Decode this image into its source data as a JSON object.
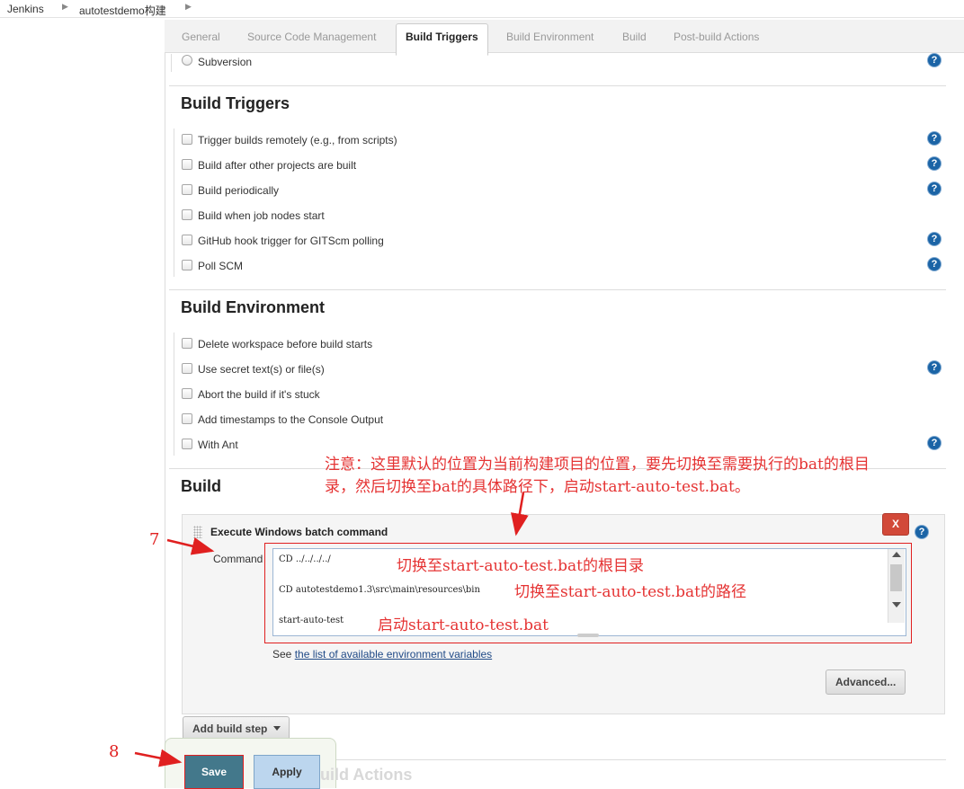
{
  "breadcrumb": {
    "home": "Jenkins",
    "job": "autotestdemo构建"
  },
  "tabs": [
    "General",
    "Source Code Management",
    "Build Triggers",
    "Build Environment",
    "Build",
    "Post-build Actions"
  ],
  "scm": {
    "subversion": "Subversion"
  },
  "build_triggers": {
    "title": "Build Triggers",
    "options": [
      "Trigger builds remotely (e.g., from scripts)",
      "Build after other projects are built",
      "Build periodically",
      "Build when job nodes start",
      "GitHub hook trigger for GITScm polling",
      "Poll SCM"
    ]
  },
  "build_env": {
    "title": "Build Environment",
    "options": [
      "Delete workspace before build starts",
      "Use secret text(s) or file(s)",
      "Abort the build if it's stuck",
      "Add timestamps to the Console Output",
      "With Ant"
    ]
  },
  "build": {
    "title": "Build",
    "step_title": "Execute Windows batch command",
    "delete_label": "X",
    "command_label": "Command",
    "command_lines": [
      "CD ../../../../",
      "CD autotestdemo1.3\\src\\main\\resources\\bin",
      "start-auto-test"
    ],
    "see_prefix": "See",
    "see_link": "the list of available environment variables",
    "advanced": "Advanced...",
    "add_step": "Add build step"
  },
  "annotations": {
    "note_line1": "注意：这里默认的位置为当前构建项目的位置，要先切换至需要执行的bat的根目",
    "note_line2": "录，然后切换至bat的具体路径下，启动start-auto-test.bat。",
    "line1": "切换至start-auto-test.bat的根目录",
    "line2": "切换至start-auto-test.bat的路径",
    "line3": "启动start-auto-test.bat",
    "step7": "7",
    "step8": "8"
  },
  "footer": {
    "save": "Save",
    "apply": "Apply",
    "hidden_section": "Post-build Actions"
  },
  "help_glyph": "?"
}
